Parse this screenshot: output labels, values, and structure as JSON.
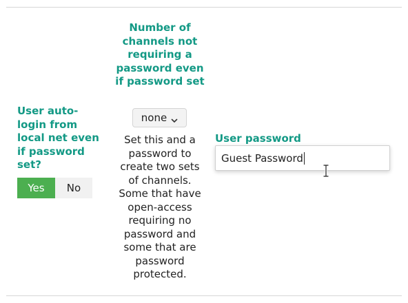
{
  "auto_login": {
    "label": "User auto-login from local net even if password set?",
    "options": {
      "yes": "Yes",
      "no": "No"
    },
    "selected": "yes",
    "active_color": "#4caf50"
  },
  "channels": {
    "label": "Number of channels not requiring a password even if password set",
    "select_value": "none",
    "description": "Set this and a password to create two sets of channels. Some that have open-access requiring no password and some that are password protected."
  },
  "user_password": {
    "label": "User password",
    "value": "Guest Password"
  },
  "colors": {
    "label_accent": "#139985"
  },
  "icons": {
    "select_chevron": "chevron-down-icon",
    "mouse_cursor": "text-cursor-icon"
  }
}
